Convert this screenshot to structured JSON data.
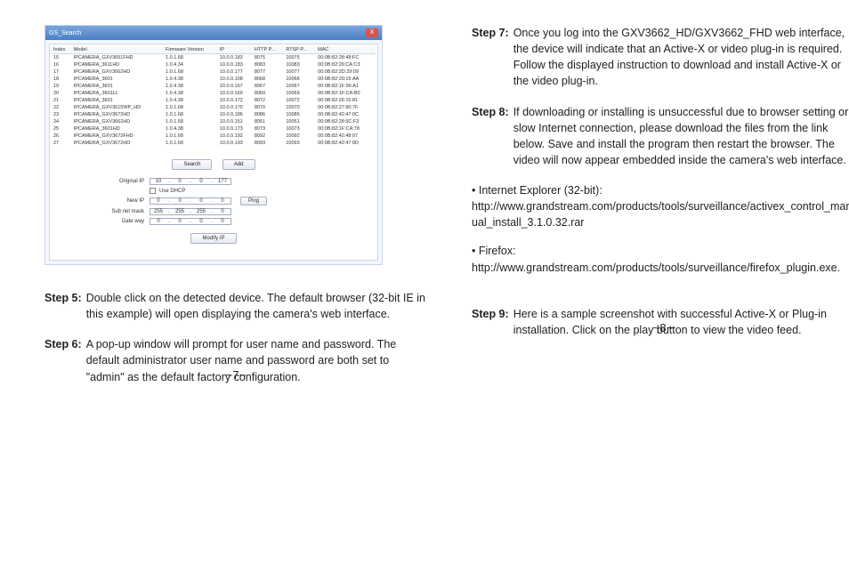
{
  "window": {
    "title": "GS_Search",
    "close": "X",
    "headers": [
      "Index",
      "Model",
      "Firmware Version",
      "IP",
      "HTTP P...",
      "RTSP P...",
      "MAC"
    ],
    "rows": [
      [
        "15",
        "IPCAMERA_GXV3651FHD",
        "1.0.1.68",
        "10.0.0.183",
        "8075",
        "10075",
        "00:0B:82:28:48:FC"
      ],
      [
        "16",
        "IPCAMERA_3611HD",
        "1.0.4.34",
        "10.0.0.183",
        "8083",
        "10083",
        "00:0B:82:26:CA:C3"
      ],
      [
        "17",
        "IPCAMERA_GXV3662HD",
        "1.0.1.68",
        "10.0.0.177",
        "8077",
        "10077",
        "00:0B:82:2D:29:09"
      ],
      [
        "18",
        "IPCAMERA_3601",
        "1.0.4.38",
        "10.0.0.168",
        "8068",
        "10068",
        "00:0B:82:20:15:AA"
      ],
      [
        "19",
        "IPCAMERA_3601",
        "1.0.4.38",
        "10.0.0.167",
        "8067",
        "10067",
        "00:0B:82:1F:96:A1"
      ],
      [
        "20",
        "IPCAMERA_3601LL",
        "1.0.4.38",
        "10.0.0.169",
        "8069",
        "10069",
        "00:0B:82:1F:CA:B0"
      ],
      [
        "21",
        "IPCAMERA_3601",
        "1.0.4.38",
        "10.0.0.172",
        "8072",
        "10072",
        "00:0B:82:26:15:81"
      ],
      [
        "22",
        "IPCAMERA_GXV3615WP_HD",
        "1.0.1.68",
        "10.0.0.170",
        "8070",
        "10070",
        "00:0B:82:27:90:7F"
      ],
      [
        "23",
        "IPCAMERA_GXV3672HD",
        "1.0.1.68",
        "10.0.0.186",
        "8086",
        "10086",
        "00:0B:82:42:47:0C"
      ],
      [
        "24",
        "IPCAMERA_GXV3662HD",
        "1.0.1.68",
        "10.0.0.151",
        "8051",
        "10051",
        "00:0B:82:28:5C:F3"
      ],
      [
        "25",
        "IPCAMERA_3601HD",
        "1.0.4.38",
        "10.0.0.173",
        "8073",
        "10073",
        "00:0B:82:1F:CA:78"
      ],
      [
        "26",
        "IPCAMERA_GXV3672FHD",
        "1.0.1.68",
        "10.0.0.192",
        "8092",
        "10092",
        "00:0B:82:42:48:07"
      ],
      [
        "27",
        "IPCAMERA_GXV3672HD",
        "1.0.1.68",
        "10.0.0.193",
        "8093",
        "10093",
        "00:0B:82:42:47:0D"
      ]
    ],
    "btn_search": "Search",
    "btn_add": "Add",
    "lbl_original": "Original IP",
    "original_ip": [
      "10",
      "0",
      "0",
      "177"
    ],
    "lbl_dhcp": "Use DHCP",
    "lbl_newip": "New IP",
    "new_ip": [
      "0",
      "0",
      "0",
      "0"
    ],
    "btn_ping": "Ping",
    "lbl_subnet": "Sub net mask",
    "subnet": [
      "255",
      "255",
      "255",
      "0"
    ],
    "lbl_gateway": "Gate way",
    "gateway": [
      "0",
      "0",
      "0",
      "0"
    ],
    "btn_modify": "Modify IP"
  },
  "steps": {
    "s5_label": "Step 5:",
    "s5_text": "Double click on the detected device. The default browser (32-bit IE in this example) will open displaying the camera's web interface.",
    "s6_label": "Step 6:",
    "s6_text": "A pop-up window will prompt for user name and password. The default administrator user name and password are both set to \"admin\" as the default factory configuration.",
    "s7_label": "Step 7:",
    "s7_text": "Once you log into the GXV3662_HD/GXV3662_FHD web interface, the device will indicate that an Active-X or video plug-in is required. Follow the displayed instruction to download and install Active-X or the video plug-in.",
    "s8_label": "Step 8:",
    "s8_text": "If downloading or installing is unsuccessful due to browser setting or slow Internet connection, please download the files from the link below. Save and install the program then restart the browser. The video will now appear embedded inside the camera's web interface.",
    "s9_label": "Step 9:",
    "s9_text": "Here is a sample screenshot with successful Active-X or Plug-in installation. Click on the play button to view the video feed."
  },
  "links": {
    "ie_label": "• Internet Explorer (32-bit):",
    "ie_url": "http://www.grandstream.com/products/tools/surveillance/activex_control_manual_install_3.1.0.32.rar",
    "ff_label": "• Firefox:",
    "ff_url": "http://www.grandstream.com/products/tools/surveillance/firefox_plugin.exe."
  },
  "pagenums": {
    "left": "~7~",
    "right": "~8~"
  }
}
